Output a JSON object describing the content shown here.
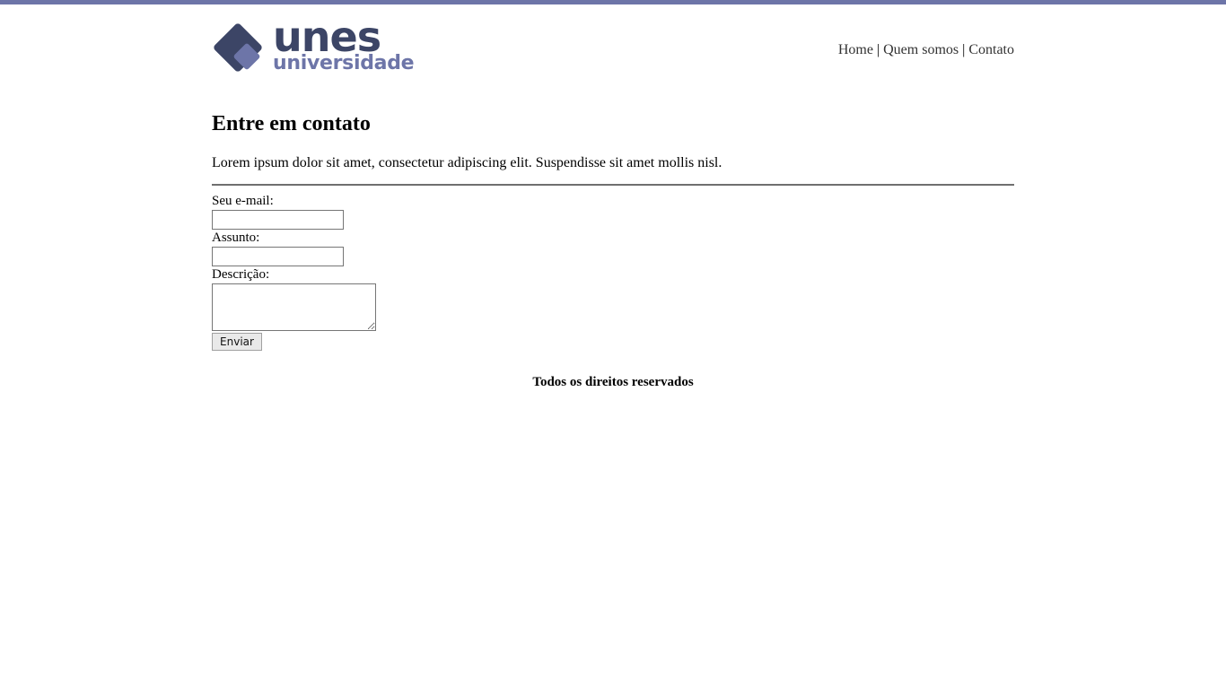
{
  "brand": {
    "name": "unes",
    "subtitle": "universidade",
    "colors": {
      "dark": "#3c4566",
      "light": "#6d75a8"
    }
  },
  "nav": {
    "items": [
      {
        "label": "Home"
      },
      {
        "label": "Quem somos"
      },
      {
        "label": "Contato"
      }
    ],
    "separator": "|"
  },
  "main": {
    "title": "Entre em contato",
    "intro": "Lorem ipsum dolor sit amet, consectetur adipiscing elit. Suspendisse sit amet mollis nisl."
  },
  "form": {
    "email_label": "Seu e-mail:",
    "email_value": "",
    "subject_label": "Assunto:",
    "subject_value": "",
    "description_label": "Descrição:",
    "description_value": "",
    "submit_label": "Enviar"
  },
  "footer": {
    "text": "Todos os direitos reservados"
  }
}
